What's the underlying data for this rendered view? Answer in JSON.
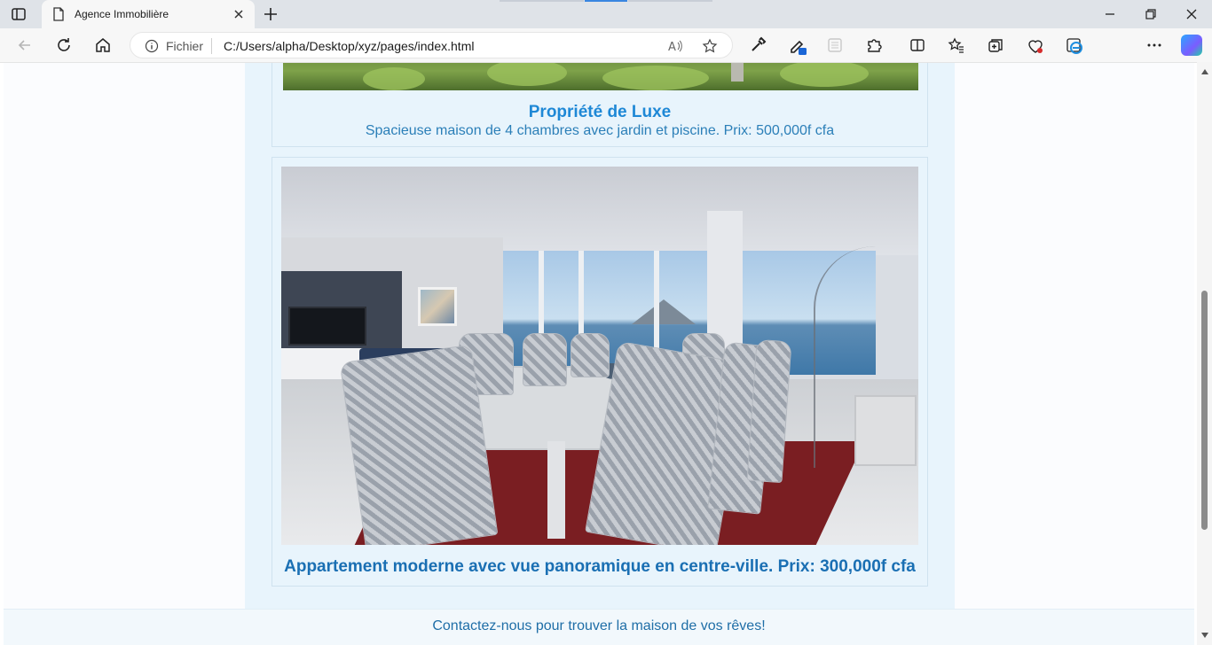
{
  "browser": {
    "tab_title": "Agence Immobilière",
    "site_label": "Fichier",
    "url": "C:/Users/alpha/Desktop/xyz/pages/index.html"
  },
  "page": {
    "card1": {
      "title": "Propriété de Luxe",
      "description": "Spacieuse maison de 4 chambres avec jardin et piscine. Prix: 500,000f cfa"
    },
    "card2": {
      "title": "Appartement moderne avec vue panoramique en centre-ville. Prix: 300,000f cfa"
    },
    "footer": "Contactez-nous pour trouver la maison de vos rêves!"
  },
  "colors": {
    "accent": "#1e88d6",
    "panel": "#e8f4fc"
  }
}
